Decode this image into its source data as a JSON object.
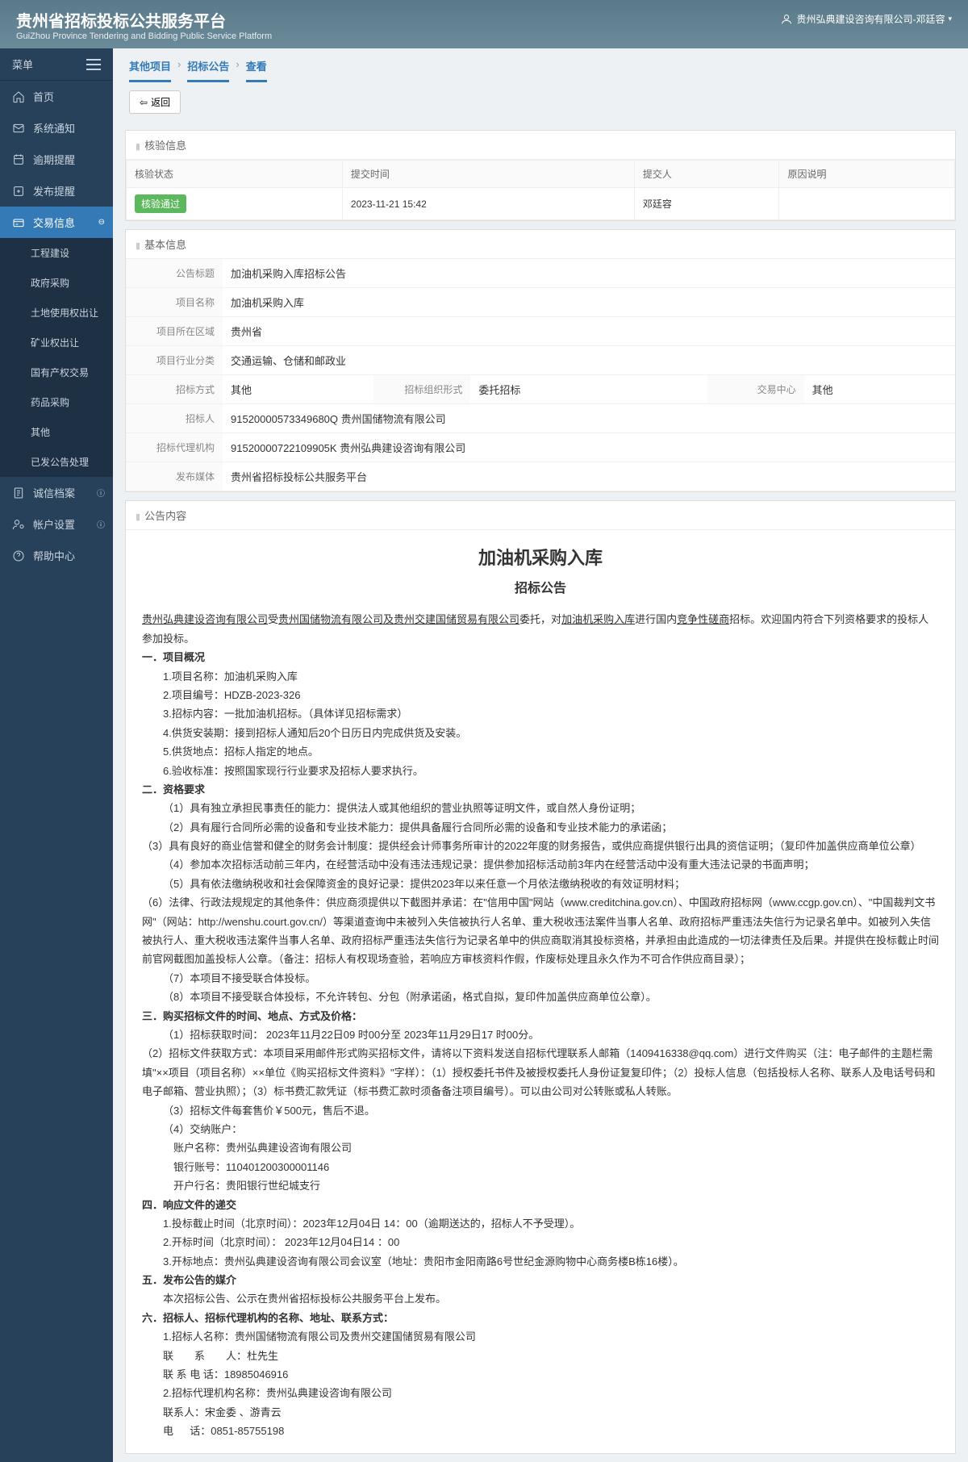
{
  "header": {
    "title": "贵州省招标投标公共服务平台",
    "subtitle": "GuiZhou Province Tendering and Bidding Public Service Platform",
    "user": "贵州弘典建设咨询有限公司-邓廷容"
  },
  "sidebar": {
    "menuLabel": "菜单",
    "items": [
      {
        "label": "首页",
        "icon": "home"
      },
      {
        "label": "系统通知",
        "icon": "message"
      },
      {
        "label": "逾期提醒",
        "icon": "bell-alert"
      },
      {
        "label": "发布提醒",
        "icon": "publish"
      },
      {
        "label": "交易信息",
        "icon": "transaction",
        "active": true,
        "sub": [
          {
            "label": "工程建设"
          },
          {
            "label": "政府采购"
          },
          {
            "label": "土地使用权出让"
          },
          {
            "label": "矿业权出让"
          },
          {
            "label": "国有产权交易"
          },
          {
            "label": "药品采购"
          },
          {
            "label": "其他"
          },
          {
            "label": "已发公告处理"
          }
        ]
      },
      {
        "label": "诚信档案",
        "icon": "file",
        "hasInfo": true
      },
      {
        "label": "帐户设置",
        "icon": "user-cog",
        "hasInfo": true
      },
      {
        "label": "帮助中心",
        "icon": "help"
      }
    ]
  },
  "breadcrumb": [
    "其他项目",
    "招标公告",
    "查看"
  ],
  "backLabel": "返回",
  "verify": {
    "title": "核验信息",
    "headers": [
      "核验状态",
      "提交时间",
      "提交人",
      "原因说明"
    ],
    "row": {
      "status": "核验通过",
      "time": "2023-11-21 15:42",
      "submitter": "邓廷容",
      "reason": ""
    }
  },
  "basic": {
    "title": "基本信息",
    "fields": {
      "noticeTitle": {
        "label": "公告标题",
        "value": "加油机采购入库招标公告"
      },
      "projectName": {
        "label": "项目名称",
        "value": "加油机采购入库"
      },
      "region": {
        "label": "项目所在区域",
        "value": "贵州省"
      },
      "industry": {
        "label": "项目行业分类",
        "value": "交通运输、仓储和邮政业"
      },
      "bidMethod": {
        "label": "招标方式",
        "value": "其他"
      },
      "orgForm": {
        "label": "招标组织形式",
        "value": "委托招标"
      },
      "center": {
        "label": "交易中心",
        "value": "其他"
      },
      "bidder": {
        "label": "招标人",
        "value": "91520000573349680Q 贵州国储物流有限公司"
      },
      "agent": {
        "label": "招标代理机构",
        "value": "91520000722109905K 贵州弘典建设咨询有限公司"
      },
      "media": {
        "label": "发布媒体",
        "value": "贵州省招标投标公共服务平台"
      }
    }
  },
  "notice": {
    "title": "公告内容",
    "mainTitle": "加油机采购入库",
    "subTitle": "招标公告",
    "intro": {
      "agent": "贵州弘典建设咨询有限公司",
      "owner": "贵州国储物流有限公司及贵州交建国储贸易有限公司",
      "project": "加油机采购入库",
      "method": "竞争性磋商",
      "text1": "受",
      "text2": "委托，对",
      "text3": "进行国内",
      "text4": "招标。欢迎国内符合下列资格要求的投标人参加投标。"
    },
    "s1": {
      "title": "一．项目概况",
      "i1": "1.项目名称：加油机采购入库",
      "i2": "2.项目编号：HDZB-2023-326",
      "i3": "3.招标内容：一批加油机招标。（具体详见招标需求）",
      "i4": "4.供货安装期：接到招标人通知后20个日历日内完成供货及安装。",
      "i5": "5.供货地点：招标人指定的地点。",
      "i6": "6.验收标准：按照国家现行行业要求及招标人要求执行。"
    },
    "s2": {
      "title": "二．资格要求",
      "i1": "（1）具有独立承担民事责任的能力：提供法人或其他组织的营业执照等证明文件，或自然人身份证明；",
      "i2": "（2）具有履行合同所必需的设备和专业技术能力：提供具备履行合同所必需的设备和专业技术能力的承诺函；",
      "i3": "（3）具有良好的商业信誉和健全的财务会计制度：提供经会计师事务所审计的2022年度的财务报告，或供应商提供银行出具的资信证明；（复印件加盖供应商单位公章）",
      "i4": "（4）参加本次招标活动前三年内，在经营活动中没有违法违规记录：提供参加招标活动前3年内在经营活动中没有重大违法记录的书面声明；",
      "i5": "（5）具有依法缴纳税收和社会保障资金的良好记录：提供2023年以来任意一个月依法缴纳税收的有效证明材料；",
      "i6": "（6）法律、行政法规规定的其他条件：供应商须提供以下截图并承诺：在\"信用中国\"网站（www.creditchina.gov.cn）、中国政府招标网（www.ccgp.gov.cn）、\"中国裁判文书网\"（网站：http://wenshu.court.gov.cn/）等渠道查询中未被列入失信被执行人名单、重大税收违法案件当事人名单、政府招标严重违法失信行为记录名单中。如被列入失信被执行人、重大税收违法案件当事人名单、政府招标严重违法失信行为记录名单中的供应商取消其投标资格，并承担由此造成的一切法律责任及后果。并提供在投标截止时间前官网截图加盖投标人公章。（备注：招标人有权现场查验，若响应方审核资料作假，作废标处理且永久作为不可合作供应商目录）；",
      "i7": "（7）本项目不接受联合体投标。",
      "i8": "（8）本项目不接受联合体投标，不允许转包、分包（附承诺函，格式自拟，复印件加盖供应商单位公章）。"
    },
    "s3": {
      "title": "三．购买招标文件的时间、地点、方式及价格：",
      "i1": "（1）招标获取时间：  2023年11月22日09 时00分至  2023年11月29日17 时00分。",
      "i2": "（2）招标文件获取方式：本项目采用邮件形式购买招标文件，请将以下资料发送自招标代理联系人邮箱（1409416338@qq.com）进行文件购买（注：电子邮件的主题栏需填\"××项目（项目名称）××单位《购买招标文件资料》\"字样）：（1）授权委托书件及被授权委托人身份证复复印件；（2）投标人信息（包括投标人名称、联系人及电话号码和电子邮箱、营业执照）；（3）标书费汇款凭证（标书费汇款时须备备注项目编号）。可以由公司对公转账或私人转账。",
      "i3": "（3）招标文件每套售价￥500元，售后不退。",
      "i4": "（4）交纳账户：",
      "bank1": "账户名称：贵州弘典建设咨询有限公司",
      "bank2": "银行账号：110401200300001146",
      "bank3": "开户行名：贵阳银行世纪城支行"
    },
    "s4": {
      "title": "四．响应文件的递交",
      "i1": "1.投标截止时间（北京时间）：2023年12月04日 14：00（逾期送达的，招标人不予受理）。",
      "i2": "2.开标时间（北京时间）：  2023年12月04日14 ：00",
      "i3": "3.开标地点：贵州弘典建设咨询有限公司会议室（地址：贵阳市金阳南路6号世纪金源购物中心商务楼B栋16楼）。"
    },
    "s5": {
      "title": "五．发布公告的媒介",
      "i1": "本次招标公告、公示在贵州省招标投标公共服务平台上发布。"
    },
    "s6": {
      "title": "六．招标人、招标代理机构的名称、地址、联系方式：",
      "i1": "1.招标人名称：贵州国储物流有限公司及贵州交建国储贸易有限公司",
      "i2": "联　　系　　人：杜先生",
      "i3": "联  系 电  话：18985046916",
      "i4": "2.招标代理机构名称：贵州弘典建设咨询有限公司",
      "i5": "联系人：宋金委 、游青云",
      "i6": "电 　 话：0851-85755198"
    }
  }
}
